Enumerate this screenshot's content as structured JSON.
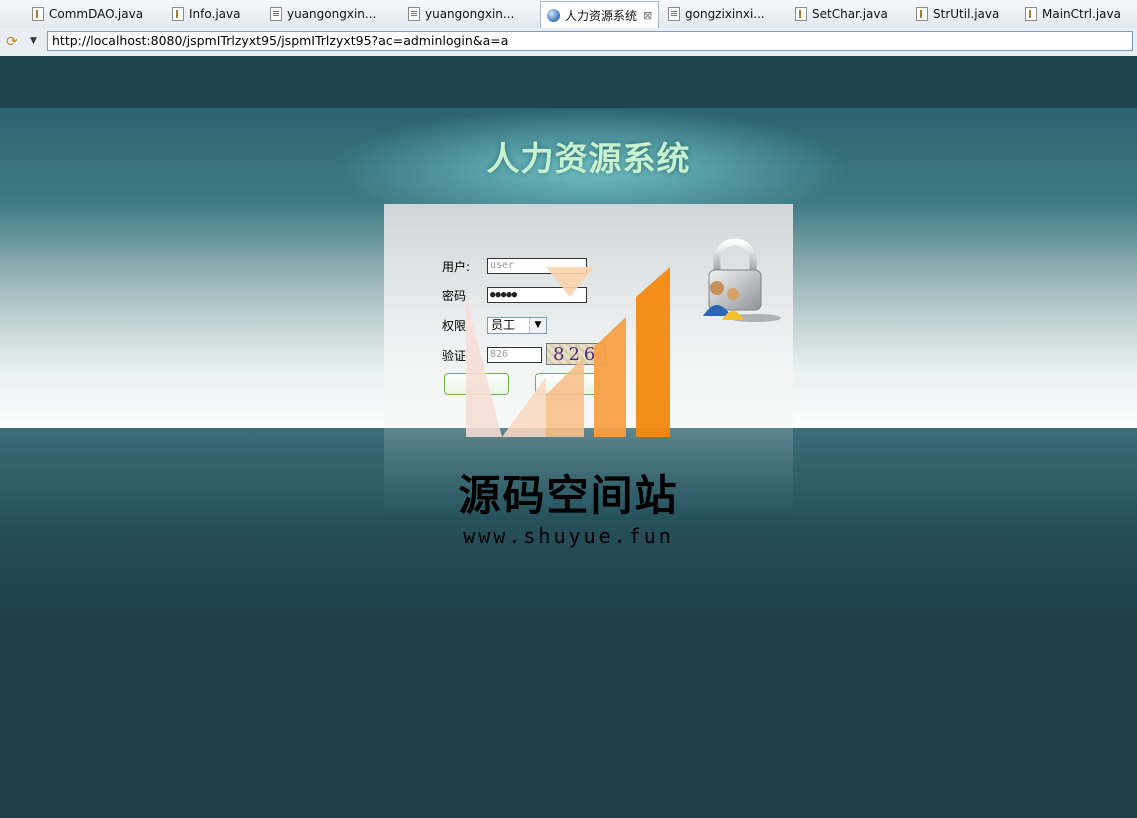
{
  "tabs": [
    {
      "label": "CommDAO.java",
      "icon": "java-file-icon"
    },
    {
      "label": "Info.java",
      "icon": "java-file-icon"
    },
    {
      "label": "yuangongxin...",
      "icon": "text-file-icon"
    },
    {
      "label": "yuangongxin...",
      "icon": "text-file-icon"
    },
    {
      "label": "人力资源系统",
      "icon": "globe-icon",
      "active": true
    },
    {
      "label": "gongzixinxi...",
      "icon": "text-file-icon"
    },
    {
      "label": "SetChar.java",
      "icon": "java-file-icon"
    },
    {
      "label": "StrUtil.java",
      "icon": "java-file-icon"
    },
    {
      "label": "MainCtrl.java",
      "icon": "java-file-icon"
    }
  ],
  "address": {
    "url": "http://localhost:8080/jspmITrlzyxt95/jspmITrlzyxt95?ac=adminlogin&a=a"
  },
  "login": {
    "title": "人力资源系统",
    "user_label": "用户:",
    "user_value": "user",
    "password_label": "密码",
    "password_value": "●●●●●",
    "role_label": "权限",
    "role_value": "员工",
    "captcha_label": "验证",
    "captcha_input": "826",
    "captcha_image": "826"
  },
  "watermark": {
    "name": "源码空间站",
    "url": "www.shuyue.fun"
  },
  "colors": {
    "title": "#c9f3cf",
    "background": "#1f3f49",
    "button_border": "#6bb84a"
  }
}
